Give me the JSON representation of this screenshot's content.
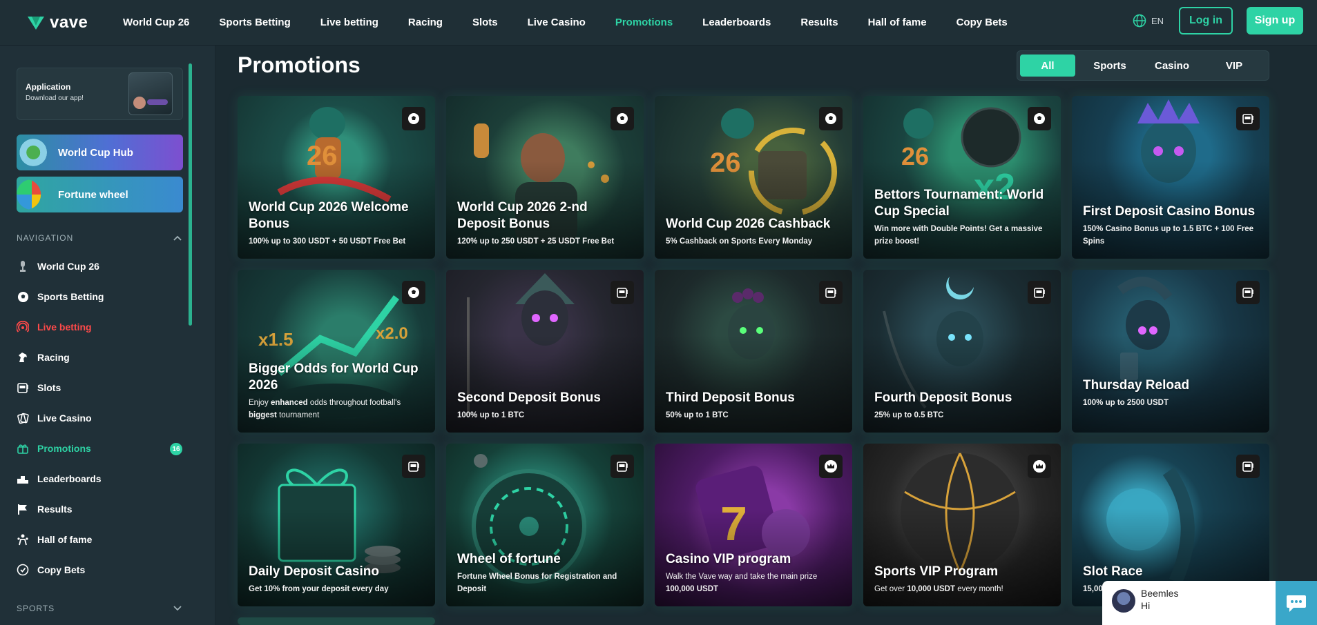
{
  "header": {
    "logo_text": "vave",
    "nav": [
      "World Cup 26",
      "Sports Betting",
      "Live betting",
      "Racing",
      "Slots",
      "Live Casino",
      "Promotions",
      "Leaderboards",
      "Results",
      "Hall of fame",
      "Copy Bets"
    ],
    "active_nav": "Promotions",
    "lang": "EN",
    "login": "Log in",
    "signup": "Sign up",
    "accent": "#2ed3a5"
  },
  "sidebar": {
    "app_title": "Application",
    "app_sub": "Download our app!",
    "hub": "World Cup Hub",
    "wheel": "Fortune wheel",
    "nav_section": "NAVIGATION",
    "items": [
      "World Cup 26",
      "Sports Betting",
      "Live betting",
      "Racing",
      "Slots",
      "Live Casino",
      "Promotions",
      "Leaderboards",
      "Results",
      "Hall of fame",
      "Copy Bets"
    ],
    "promo_badge": "16",
    "sports_section": "SPORTS"
  },
  "main": {
    "title": "Promotions",
    "filters": [
      "All",
      "Sports",
      "Casino",
      "VIP"
    ],
    "active_filter": "All"
  },
  "cards": [
    {
      "title": "World Cup 2026 Welcome Bonus",
      "sub": "100% up to 300 USDT + 50 USDT Free Bet",
      "icon": "soccer-ball-icon"
    },
    {
      "title": "World Cup 2026 2-nd Deposit Bonus",
      "sub": "120% up to 250 USDT + 25 USDT Free Bet",
      "icon": "soccer-ball-icon"
    },
    {
      "title": "World Cup 2026 Cashback",
      "sub": "5% Cashback on Sports Every Monday",
      "icon": "soccer-ball-icon"
    },
    {
      "title": "Bettors Tournament: World Cup Special",
      "sub": "Win more with Double Points! Get a massive prize boost!",
      "icon": "soccer-ball-icon"
    },
    {
      "title": "First Deposit Casino Bonus",
      "sub": "150% Casino Bonus up to 1.5 BTC + 100 Free Spins",
      "icon": "slot-machine-icon"
    },
    {
      "title": "Bigger Odds for World Cup 2026",
      "sub_parts": [
        "Enjoy ",
        "enhanced",
        " odds throughout football's ",
        "biggest",
        " tournament"
      ],
      "icon": "soccer-ball-icon"
    },
    {
      "title": "Second Deposit Bonus",
      "sub": "100% up to 1 BTC",
      "icon": "slot-machine-icon"
    },
    {
      "title": "Third Deposit Bonus",
      "sub": "50% up to 1 BTC",
      "icon": "slot-machine-icon"
    },
    {
      "title": "Fourth Deposit Bonus",
      "sub": "25% up to 0.5 BTC",
      "icon": "slot-machine-icon"
    },
    {
      "title": "Thursday Reload",
      "sub": "100% up to 2500 USDT",
      "icon": "slot-machine-icon"
    },
    {
      "title": "Daily Deposit Casino",
      "sub": "Get 10% from your deposit every day",
      "icon": "slot-machine-icon"
    },
    {
      "title": "Wheel of fortune",
      "sub": "Fortune Wheel Bonus for Registration and Deposit",
      "icon": "slot-machine-icon"
    },
    {
      "title": "Casino VIP program",
      "sub_line1": "Walk the Vave way and take the main prize",
      "sub_line2": "100,000 USDT",
      "icon": "crown-icon"
    },
    {
      "title": "Sports VIP Program",
      "sub_parts": [
        "Get over ",
        "10,000 USDT",
        " every month!"
      ],
      "icon": "crown-icon"
    },
    {
      "title": "Slot Race",
      "sub": "15,00",
      "icon": "slot-machine-icon"
    }
  ],
  "chat": {
    "name": "Beemles",
    "msg": "Hi"
  }
}
